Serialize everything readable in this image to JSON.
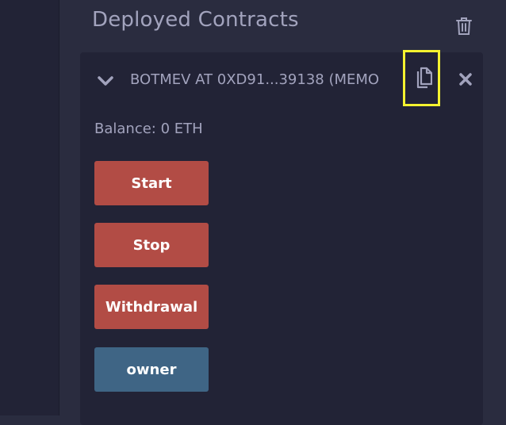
{
  "panel": {
    "title": "Deployed Contracts",
    "trash_icon": "trash-icon"
  },
  "contract": {
    "label": "BOTMEV AT 0XD91...39138 (MEMO",
    "balance": "Balance: 0 ETH",
    "icons": {
      "expand": "chevron-down-icon",
      "copy": "copy-icon",
      "close": "close-icon"
    },
    "buttons": [
      {
        "label": "Start",
        "color": "#b24c45"
      },
      {
        "label": "Stop",
        "color": "#b24c45"
      },
      {
        "label": "Withdrawal",
        "color": "#b24c45"
      },
      {
        "label": "owner",
        "color": "#3f6585"
      }
    ]
  },
  "colors": {
    "background": "#2a2c3f",
    "card": "#222336",
    "text": "#a2a3bd",
    "highlight": "#f4f22f"
  }
}
